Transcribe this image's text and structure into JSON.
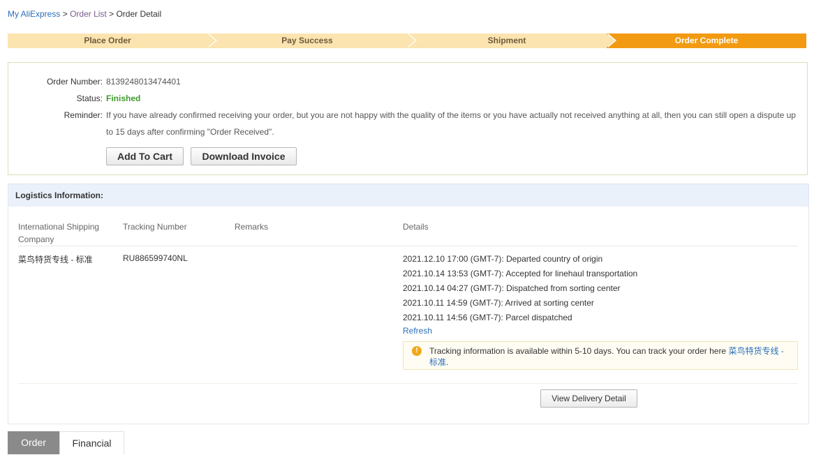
{
  "breadcrumb": {
    "home": "My AliExpress",
    "sep1": ">",
    "list": "Order List",
    "sep2": ">",
    "current": "Order Detail"
  },
  "steps": [
    "Place Order",
    "Pay Success",
    "Shipment",
    "Order Complete"
  ],
  "active_step": "Order Complete",
  "order": {
    "number_label": "Order Number:",
    "number": "8139248013474401",
    "status_label": "Status:",
    "status": "Finished",
    "reminder_label": "Reminder:",
    "reminder": "If you have already confirmed receiving your order, but you are not happy with the quality of the items or you have actually not received anything at all, then you can still open a dispute up to 15 days after confirming \"Order Received\".",
    "add_to_cart": "Add To Cart",
    "download_invoice": "Download Invoice"
  },
  "logistics": {
    "title": "Logistics Information:",
    "columns": [
      "International Shipping Company",
      "Tracking Number",
      "Remarks",
      "Details"
    ],
    "company": "菜鸟特货专线 - 标准",
    "tracking_number": "RU886599740NL",
    "remarks": "",
    "events": [
      "2021.12.10 17:00 (GMT-7): Departed country of origin",
      "2021.10.14 13:53 (GMT-7): Accepted for linehaul transportation",
      "2021.10.14 04:27 (GMT-7): Dispatched from sorting center",
      "2021.10.11 14:59 (GMT-7): Arrived at sorting center",
      "2021.10.11 14:56 (GMT-7): Parcel dispatched"
    ],
    "refresh": "Refresh",
    "tip_text": "Tracking information is available within 5-10 days. You can track your order here",
    "tip_link": "菜鸟特货专线 - 标准",
    "tip_end": ".",
    "view_delivery": "View Delivery Detail"
  },
  "tabs": [
    "Order",
    "Financial"
  ],
  "colors": {
    "accent": "#f29a11",
    "step_bg": "#fbe4b0",
    "link": "#2a6ebb",
    "status_green": "#3f9a2e"
  }
}
